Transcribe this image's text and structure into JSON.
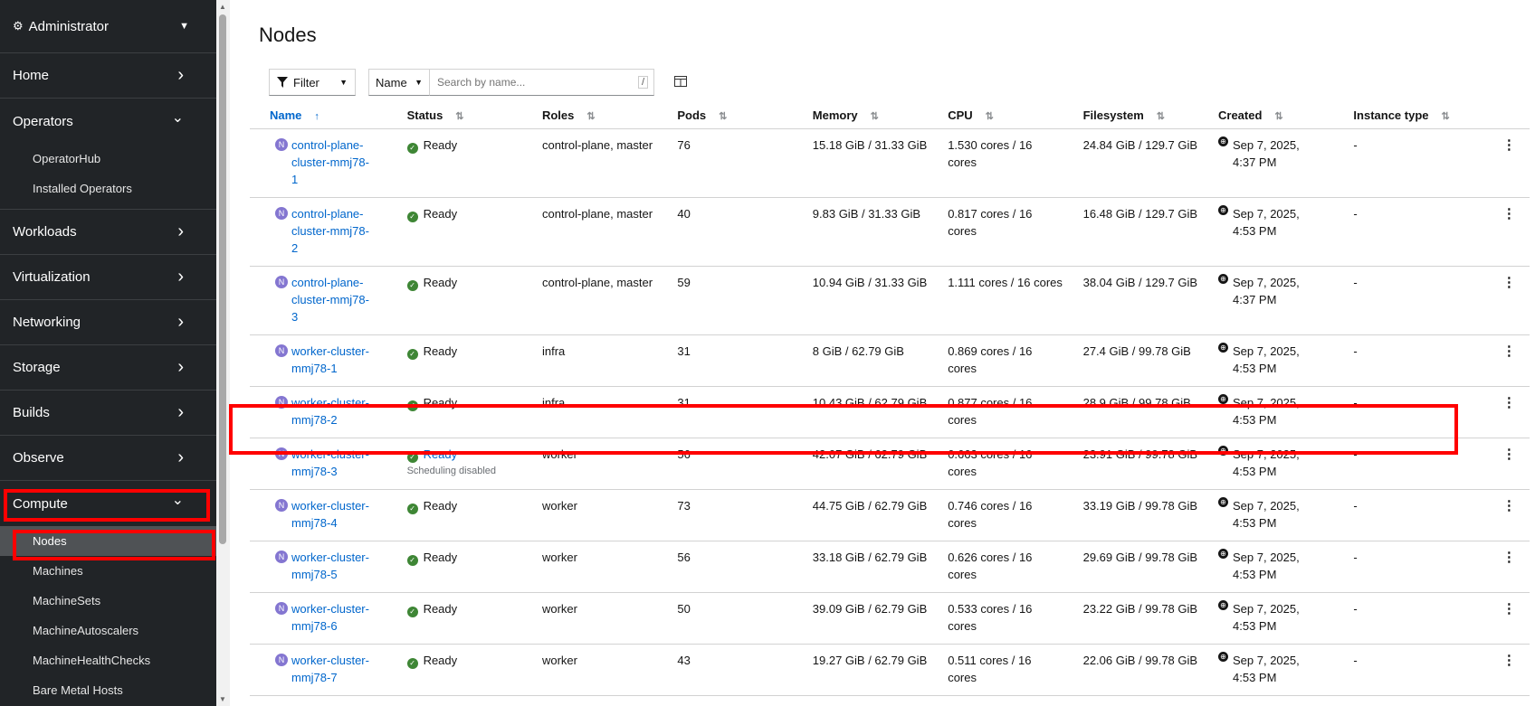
{
  "sidebar": {
    "perspective": "Administrator",
    "sections": [
      {
        "label": "Home",
        "expanded": false
      },
      {
        "label": "Operators",
        "expanded": true,
        "items": [
          "OperatorHub",
          "Installed Operators"
        ]
      },
      {
        "label": "Workloads",
        "expanded": false
      },
      {
        "label": "Virtualization",
        "expanded": false
      },
      {
        "label": "Networking",
        "expanded": false
      },
      {
        "label": "Storage",
        "expanded": false
      },
      {
        "label": "Builds",
        "expanded": false
      },
      {
        "label": "Observe",
        "expanded": false
      },
      {
        "label": "Compute",
        "expanded": true,
        "items": [
          "Nodes",
          "Machines",
          "MachineSets",
          "MachineAutoscalers",
          "MachineHealthChecks",
          "Bare Metal Hosts"
        ]
      }
    ],
    "active_item": "Nodes"
  },
  "page": {
    "title": "Nodes",
    "filter_label": "Filter",
    "name_select": "Name",
    "search_placeholder": "Search by name...",
    "search_shortcut": "/"
  },
  "table": {
    "columns": [
      "Name",
      "Status",
      "Roles",
      "Pods",
      "Memory",
      "CPU",
      "Filesystem",
      "Created",
      "Instance type"
    ],
    "sorted_column": "Name",
    "rows": [
      {
        "badge": "N",
        "name": "control-plane-cluster-mmj78-1",
        "status": "Ready",
        "status_sub": "",
        "roles": "control-plane, master",
        "pods": "76",
        "memory": "15.18 GiB / 31.33 GiB",
        "cpu": "1.530 cores / 16 cores",
        "fs": "24.84 GiB / 129.7 GiB",
        "created": "Sep 7, 2025, 4:37 PM",
        "instance": "-"
      },
      {
        "badge": "N",
        "name": "control-plane-cluster-mmj78-2",
        "status": "Ready",
        "status_sub": "",
        "roles": "control-plane, master",
        "pods": "40",
        "memory": "9.83 GiB / 31.33 GiB",
        "cpu": "0.817 cores / 16 cores",
        "fs": "16.48 GiB / 129.7 GiB",
        "created": "Sep 7, 2025, 4:53 PM",
        "instance": "-"
      },
      {
        "badge": "N",
        "name": "control-plane-cluster-mmj78-3",
        "status": "Ready",
        "status_sub": "",
        "roles": "control-plane, master",
        "pods": "59",
        "memory": "10.94 GiB / 31.33 GiB",
        "cpu": "1.111 cores / 16 cores",
        "fs": "38.04 GiB / 129.7 GiB",
        "created": "Sep 7, 2025, 4:37 PM",
        "instance": "-"
      },
      {
        "badge": "N",
        "name": "worker-cluster-mmj78-1",
        "status": "Ready",
        "status_sub": "",
        "roles": "infra",
        "pods": "31",
        "memory": "8 GiB / 62.79 GiB",
        "cpu": "0.869 cores / 16 cores",
        "fs": "27.4 GiB / 99.78 GiB",
        "created": "Sep 7, 2025, 4:53 PM",
        "instance": "-"
      },
      {
        "badge": "N",
        "name": "worker-cluster-mmj78-2",
        "status": "Ready",
        "status_sub": "",
        "roles": "infra",
        "pods": "31",
        "memory": "10.43 GiB / 62.79 GiB",
        "cpu": "0.877 cores / 16 cores",
        "fs": "28.9 GiB / 99.78 GiB",
        "created": "Sep 7, 2025, 4:53 PM",
        "instance": "-"
      },
      {
        "badge": "N",
        "name": "worker-cluster-mmj78-3",
        "status": "Ready",
        "status_sub": "Scheduling disabled",
        "roles": "worker",
        "pods": "56",
        "memory": "42.07 GiB / 62.79 GiB",
        "cpu": "0.663 cores / 16 cores",
        "fs": "23.91 GiB / 99.78 GiB",
        "created": "Sep 7, 2025, 4:53 PM",
        "instance": "-"
      },
      {
        "badge": "N",
        "name": "worker-cluster-mmj78-4",
        "status": "Ready",
        "status_sub": "",
        "roles": "worker",
        "pods": "73",
        "memory": "44.75 GiB / 62.79 GiB",
        "cpu": "0.746 cores / 16 cores",
        "fs": "33.19 GiB / 99.78 GiB",
        "created": "Sep 7, 2025, 4:53 PM",
        "instance": "-"
      },
      {
        "badge": "N",
        "name": "worker-cluster-mmj78-5",
        "status": "Ready",
        "status_sub": "",
        "roles": "worker",
        "pods": "56",
        "memory": "33.18 GiB / 62.79 GiB",
        "cpu": "0.626 cores / 16 cores",
        "fs": "29.69 GiB / 99.78 GiB",
        "created": "Sep 7, 2025, 4:53 PM",
        "instance": "-"
      },
      {
        "badge": "N",
        "name": "worker-cluster-mmj78-6",
        "status": "Ready",
        "status_sub": "",
        "roles": "worker",
        "pods": "50",
        "memory": "39.09 GiB / 62.79 GiB",
        "cpu": "0.533 cores / 16 cores",
        "fs": "23.22 GiB / 99.78 GiB",
        "created": "Sep 7, 2025, 4:53 PM",
        "instance": "-"
      },
      {
        "badge": "N",
        "name": "worker-cluster-mmj78-7",
        "status": "Ready",
        "status_sub": "",
        "roles": "worker",
        "pods": "43",
        "memory": "19.27 GiB / 62.79 GiB",
        "cpu": "0.511 cores / 16 cores",
        "fs": "22.06 GiB / 99.78 GiB",
        "created": "Sep 7, 2025, 4:53 PM",
        "instance": "-"
      }
    ]
  },
  "colors": {
    "link": "#0066cc",
    "ready": "#3e8635",
    "highlight": "#ff0000",
    "sidebar_bg": "#212427",
    "node_badge": "#8476d1"
  },
  "icons": {
    "perspective": "gear-icon",
    "filter": "filter-icon",
    "columns": "column-management-icon",
    "created": "globe-icon",
    "kebab": "kebab-icon",
    "ready": "check-circle-icon"
  }
}
